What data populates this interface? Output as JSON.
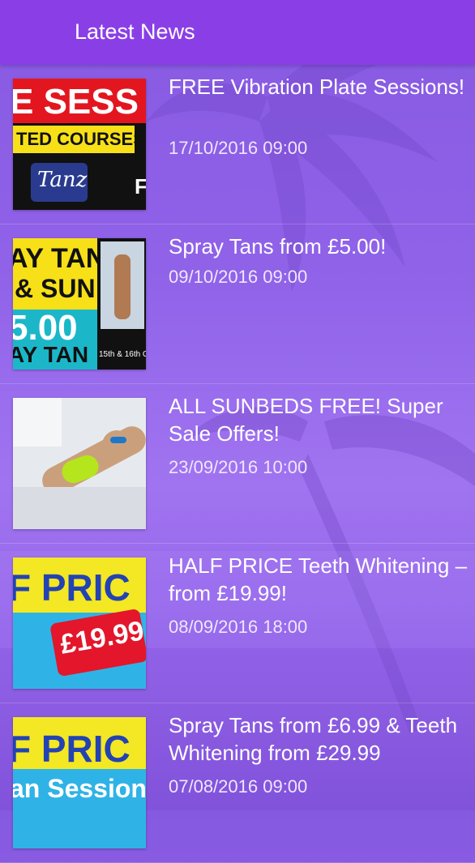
{
  "header": {
    "title": "Latest News"
  },
  "colors": {
    "appbar": "#8a3fe6",
    "background": "#8a5ae8",
    "text": "#ffffff"
  },
  "news": [
    {
      "title": "FREE Vibration Plate Sessions!",
      "date": "17/10/2016 09:00",
      "thumb_text": [
        "E SESS",
        "TED COURSES",
        "Tanz",
        "F"
      ]
    },
    {
      "title": "Spray Tans from £5.00!",
      "date": "09/10/2016 09:00",
      "thumb_text": [
        "AY TAN",
        "& SUN",
        "5.00",
        "AY TAN",
        "15th & 16th C"
      ]
    },
    {
      "title": "ALL SUNBEDS FREE! Super Sale Offers!",
      "date": "23/09/2016 10:00"
    },
    {
      "title": "HALF PRICE Teeth Whitening – from £19.99!",
      "date": "08/09/2016 18:00",
      "thumb_text": [
        "F PRIC",
        "£19.99"
      ]
    },
    {
      "title": "Spray Tans from £6.99 & Teeth Whitening from £29.99",
      "date": "07/08/2016 09:00",
      "thumb_text": [
        "F PRIC",
        "an Session"
      ]
    }
  ]
}
